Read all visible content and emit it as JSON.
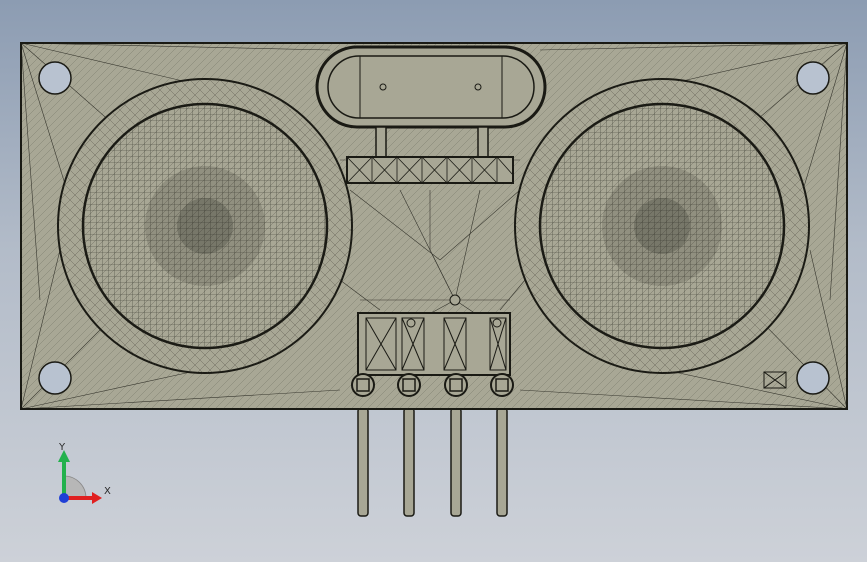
{
  "viewport": {
    "background_top": "#8c9cb2",
    "background_bottom": "#cdd1d8",
    "model_fill": "#a8a795",
    "model_line": "#1a1a14"
  },
  "model": {
    "name": "ultrasonic-sensor-module",
    "pin_count": 4,
    "transducer_count": 2,
    "mount_hole_count": 4
  },
  "triad": {
    "y_label": "Y",
    "x_label": "X",
    "y_color": "#22b14c",
    "x_color": "#e02020",
    "z_color": "#1f3fd6"
  }
}
